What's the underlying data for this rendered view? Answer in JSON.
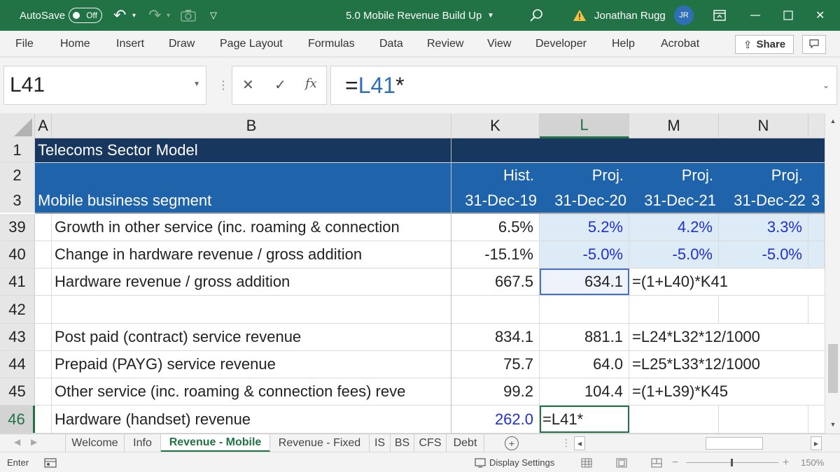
{
  "titlebar": {
    "autosave_label": "AutoSave",
    "autosave_state": "Off",
    "doc_title": "5.0 Mobile Revenue Build Up",
    "user_name": "Jonathan Rugg",
    "user_initials": "JR"
  },
  "menu": [
    "File",
    "Home",
    "Insert",
    "Draw",
    "Page Layout",
    "Formulas",
    "Data",
    "Review",
    "View",
    "Developer",
    "Help",
    "Acrobat"
  ],
  "share_label": "Share",
  "formula_bar": {
    "name_box": "L41",
    "prefix": "=",
    "ref": "L41",
    "suffix": "*"
  },
  "columns": [
    "A",
    "B",
    "K",
    "L",
    "M",
    "N"
  ],
  "rows": {
    "r1": {
      "num": "1",
      "label": "Telecoms Sector Model"
    },
    "r2": {
      "num": "2",
      "k": "Hist.",
      "l": "Proj.",
      "m": "Proj.",
      "n": "Proj."
    },
    "r3": {
      "num": "3",
      "label": "Mobile business segment",
      "k": "31-Dec-19",
      "l": "31-Dec-20",
      "m": "31-Dec-21",
      "n": "31-Dec-22",
      "o": "3"
    },
    "r39": {
      "num": "39",
      "label": "Growth in other service (inc. roaming & connection",
      "k": "6.5%",
      "l": "5.2%",
      "m": "4.2%",
      "n": "3.3%"
    },
    "r40": {
      "num": "40",
      "label": "Change in hardware revenue / gross addition",
      "k": "-15.1%",
      "l": "-5.0%",
      "m": "-5.0%",
      "n": "-5.0%"
    },
    "r41": {
      "num": "41",
      "label": "Hardware revenue / gross addition",
      "k": "667.5",
      "l": "634.1",
      "m": "=(1+L40)*K41"
    },
    "r42": {
      "num": "42"
    },
    "r43": {
      "num": "43",
      "label": "Post paid (contract) service revenue",
      "k": "834.1",
      "l": "881.1",
      "m": "=L24*L32*12/1000"
    },
    "r44": {
      "num": "44",
      "label": "Prepaid (PAYG) service revenue",
      "k": "75.7",
      "l": "64.0",
      "m": "=L25*L33*12/1000"
    },
    "r45": {
      "num": "45",
      "label": "Other service (inc. roaming & connection fees) reve",
      "k": "99.2",
      "l": "104.4",
      "m": "=(1+L39)*K45"
    },
    "r46": {
      "num": "46",
      "label": "Hardware (handset) revenue",
      "k": "262.0",
      "l": "=L41*"
    }
  },
  "sheets": [
    "Welcome",
    "Info",
    "Revenue - Mobile",
    "Revenue - Fixed",
    "IS",
    "BS",
    "CFS",
    "Debt"
  ],
  "status": {
    "mode": "Enter",
    "display_settings": "Display Settings",
    "zoom": "150%"
  },
  "colors": {
    "excel_green": "#217346",
    "band_dark": "#17375e",
    "band_blue": "#1f63aa",
    "input_fill": "#ddebf7",
    "input_font": "#1f2fd0"
  }
}
